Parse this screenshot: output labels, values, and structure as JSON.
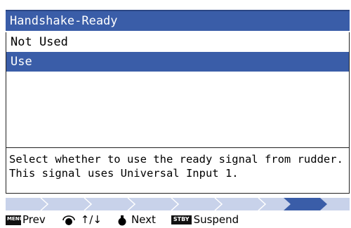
{
  "title": "Handshake-Ready",
  "options": [
    {
      "label": "Not Used",
      "selected": false
    },
    {
      "label": "Use",
      "selected": true
    }
  ],
  "description": {
    "line1": "Select whether to use the ready signal from rudder.",
    "line2": "This signal uses Universal Input 1."
  },
  "progress": {
    "total_steps": 10,
    "current_step": 9
  },
  "footer": {
    "prev_key": "MENU/ESC",
    "prev_label": "Prev",
    "arrows_label": "↑/↓",
    "next_label": "Next",
    "suspend_key": "STBY",
    "suspend_label": "Suspend"
  },
  "colors": {
    "accent": "#3a5da8",
    "progress_inactive": "#c8d2ea"
  }
}
